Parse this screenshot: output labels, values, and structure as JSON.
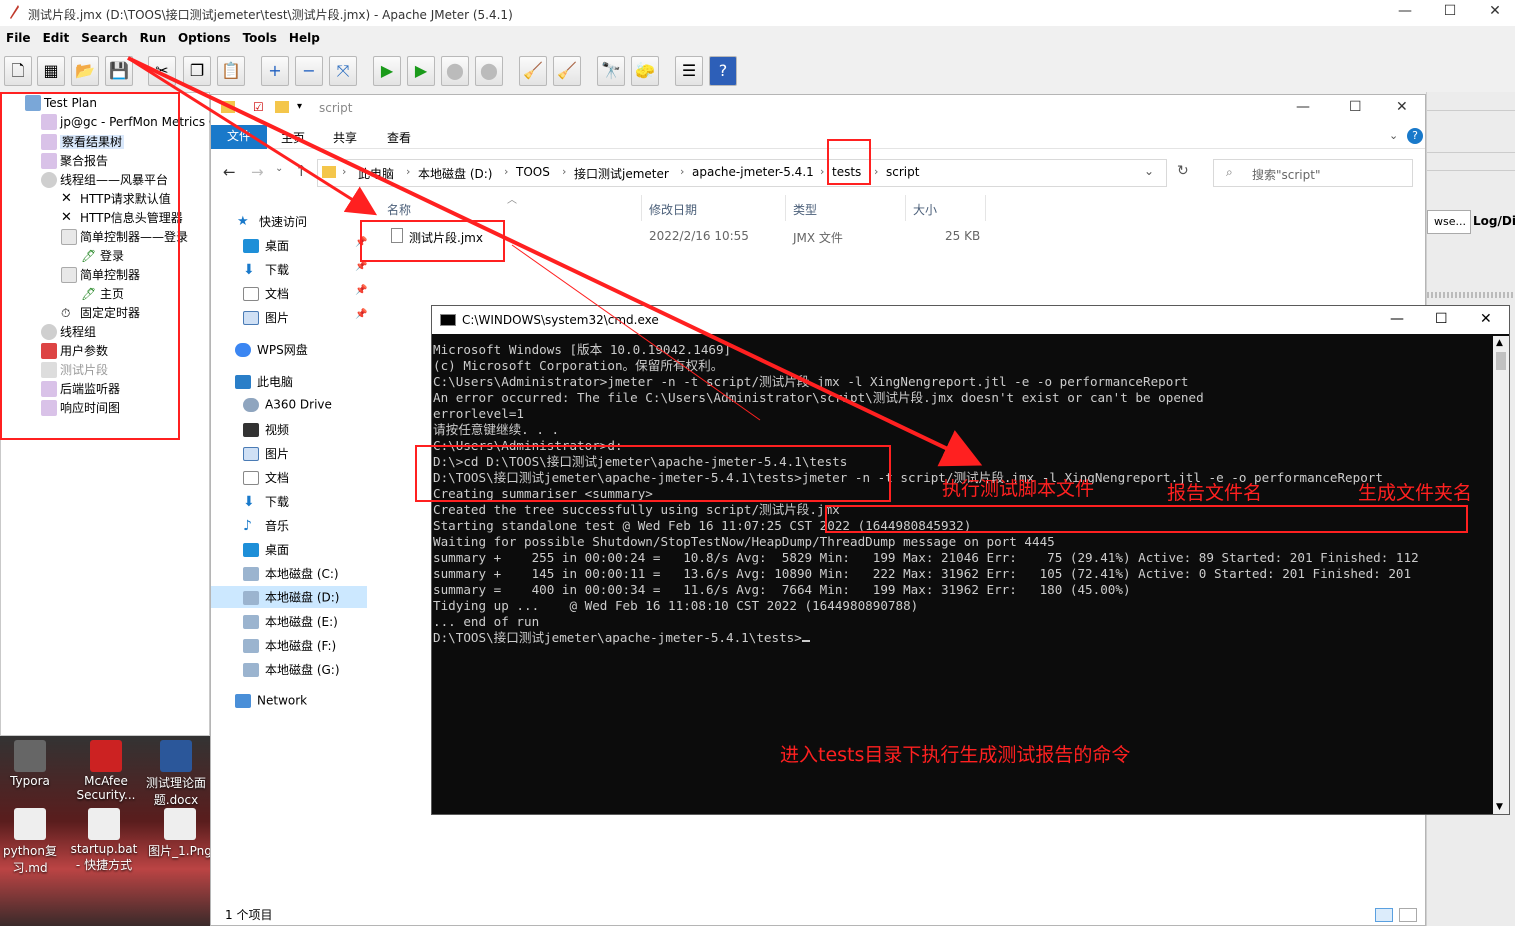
{
  "jmeter": {
    "title": "测试片段.jmx (D:\\TOOS\\接口测试jemeter\\test\\测试片段.jmx) - Apache JMeter (5.4.1)",
    "menu": [
      "File",
      "Edit",
      "Search",
      "Run",
      "Options",
      "Tools",
      "Help"
    ],
    "tree": [
      {
        "label": "Test Plan"
      },
      {
        "label": "jp@gc - PerfMon Metrics Co"
      },
      {
        "label": "察看结果树"
      },
      {
        "label": "聚合报告"
      },
      {
        "label": "线程组——风暴平台"
      },
      {
        "label": "HTTP请求默认值"
      },
      {
        "label": "HTTP信息头管理器"
      },
      {
        "label": "简单控制器——登录"
      },
      {
        "label": "登录"
      },
      {
        "label": "简单控制器"
      },
      {
        "label": "主页"
      },
      {
        "label": "固定定时器"
      },
      {
        "label": "线程组"
      },
      {
        "label": "用户参数"
      },
      {
        "label": "测试片段"
      },
      {
        "label": "后端监听器"
      },
      {
        "label": "响应时间图"
      }
    ],
    "right_panel": {
      "browse": "wse...",
      "log": "Log/Dis"
    }
  },
  "desktop": {
    "icons": [
      "Typora",
      "McAfee Security...",
      "测试理论面题.docx",
      "python复习.md",
      "startup.bat - 快捷方式",
      "图片_1.Png"
    ]
  },
  "explorer": {
    "title": "script",
    "ribbon_tabs": [
      "文件",
      "主页",
      "共享",
      "查看"
    ],
    "breadcrumb": [
      "此电脑",
      "本地磁盘 (D:)",
      "TOOS",
      "接口测试jemeter",
      "apache-jmeter-5.4.1",
      "tests",
      "script"
    ],
    "search_placeholder": "搜索\"script\"",
    "columns": [
      "名称",
      "修改日期",
      "类型",
      "大小"
    ],
    "file": {
      "name": "测试片段.jmx",
      "date": "2022/2/16 10:55",
      "type": "JMX 文件",
      "size": "25 KB"
    },
    "nav": [
      {
        "label": "快速访问"
      },
      {
        "label": "桌面"
      },
      {
        "label": "下载"
      },
      {
        "label": "文档"
      },
      {
        "label": "图片"
      },
      {
        "label": "WPS网盘"
      },
      {
        "label": "此电脑"
      },
      {
        "label": "A360 Drive"
      },
      {
        "label": "视频"
      },
      {
        "label": "图片"
      },
      {
        "label": "文档"
      },
      {
        "label": "下载"
      },
      {
        "label": "音乐"
      },
      {
        "label": "桌面"
      },
      {
        "label": "本地磁盘 (C:)"
      },
      {
        "label": "本地磁盘 (D:)"
      },
      {
        "label": "本地磁盘 (E:)"
      },
      {
        "label": "本地磁盘 (F:)"
      },
      {
        "label": "本地磁盘 (G:)"
      },
      {
        "label": "Network"
      }
    ],
    "status": "1 个项目"
  },
  "cmd": {
    "title": "C:\\WINDOWS\\system32\\cmd.exe",
    "lines": [
      "Microsoft Windows [版本 10.0.19042.1469]",
      "(c) Microsoft Corporation。保留所有权利。",
      "",
      "C:\\Users\\Administrator>jmeter -n -t script/测试片段.jmx -l XingNengreport.jtl -e -o performanceReport",
      "An error occurred: The file C:\\Users\\Administrator\\script\\测试片段.jmx doesn't exist or can't be opened",
      "errorlevel=1",
      "请按任意键继续. . .",
      "C:\\Users\\Administrator>d:",
      "",
      "D:\\>cd D:\\TOOS\\接口测试jemeter\\apache-jmeter-5.4.1\\tests",
      "",
      "D:\\TOOS\\接口测试jemeter\\apache-jmeter-5.4.1\\tests>jmeter -n -t script/测试片段.jmx -l XingNengreport.jtl -e -o performanceReport",
      "Creating summariser <summary>",
      "Created the tree successfully using script/测试片段.jmx",
      "Starting standalone test @ Wed Feb 16 11:07:25 CST 2022 (1644980845932)",
      "Waiting for possible Shutdown/StopTestNow/HeapDump/ThreadDump message on port 4445",
      "summary +    255 in 00:00:24 =   10.8/s Avg:  5829 Min:   199 Max: 21046 Err:    75 (29.41%) Active: 89 Started: 201 Finished: 112",
      "summary +    145 in 00:00:11 =   13.6/s Avg: 10890 Min:   222 Max: 31962 Err:   105 (72.41%) Active: 0 Started: 201 Finished: 201",
      "summary =    400 in 00:00:34 =   11.6/s Avg:  7664 Min:   199 Max: 31962 Err:   180 (45.00%)",
      "Tidying up ...    @ Wed Feb 16 11:08:10 CST 2022 (1644980890788)",
      "... end of run",
      "",
      "D:\\TOOS\\接口测试jemeter\\apache-jmeter-5.4.1\\tests>"
    ]
  },
  "annotations": {
    "run_script": "执行测试脚本文件",
    "report_file": "报告文件名",
    "output_folder": "生成文件夹名",
    "summary": "进入tests目录下执行生成测试报告的命令"
  },
  "colors": {
    "annotation": "#ff2020",
    "explorer_accent": "#1979ca",
    "cmd_bg": "#0c0c0c",
    "cmd_text": "#cccccc"
  }
}
